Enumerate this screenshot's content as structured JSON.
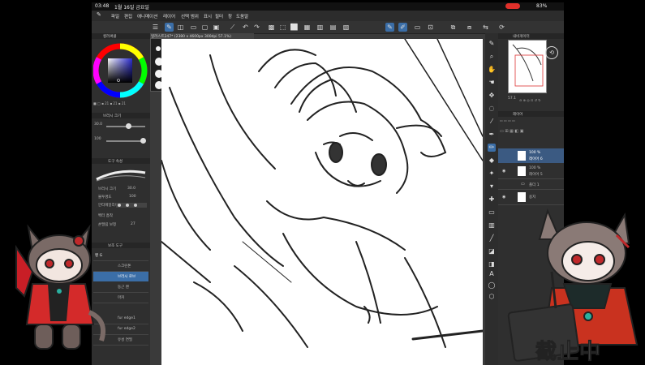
{
  "status": {
    "time": "03:48",
    "date": "1월 16일 금요일",
    "battery": "83%"
  },
  "menu": [
    "파일",
    "편집",
    "애니메이션",
    "레이어",
    "선택 범위",
    "표시",
    "필터",
    "창",
    "도움말"
  ],
  "tab": {
    "title": "일러스트247* (2380 x 4600px 300dpi 57.1%)"
  },
  "left": {
    "color_head": "컬러써클",
    "brush_head": "브러시 크기",
    "size_value": "30.0",
    "opacity_value": "100",
    "tool_head": "도구 속성",
    "brush_size_label": "브러시 크기",
    "brush_size_value": "30.0",
    "opacity_label": "불투명도",
    "opacity_val": "100",
    "antialias_label": "안티에일리어싱",
    "stabilize_label": "벡터 흡착",
    "correction_label": "손떨림 보정",
    "correction_value": "27",
    "sub_head": "보조 도구",
    "brushes": [
      "펜 G",
      "스크린톤",
      "브러시 로브",
      "둥근 펜",
      "마커",
      "fur edge1",
      "fur edge2",
      "유성 연필"
    ]
  },
  "right": {
    "navigator_head": "내비게이터",
    "zoom": "57.1",
    "layer_head": "레이어",
    "layers": [
      {
        "name": "레이어 6",
        "opacity": "100 %"
      },
      {
        "name": "레이어 5",
        "opacity": "100 %"
      },
      {
        "name": "폴더 1",
        "opacity": ""
      },
      {
        "name": "용지",
        "opacity": ""
      }
    ]
  },
  "overlay": {
    "stop_text": "截止中"
  },
  "colors": {
    "accent": "#3b6ea7",
    "record": "#e0302a"
  }
}
